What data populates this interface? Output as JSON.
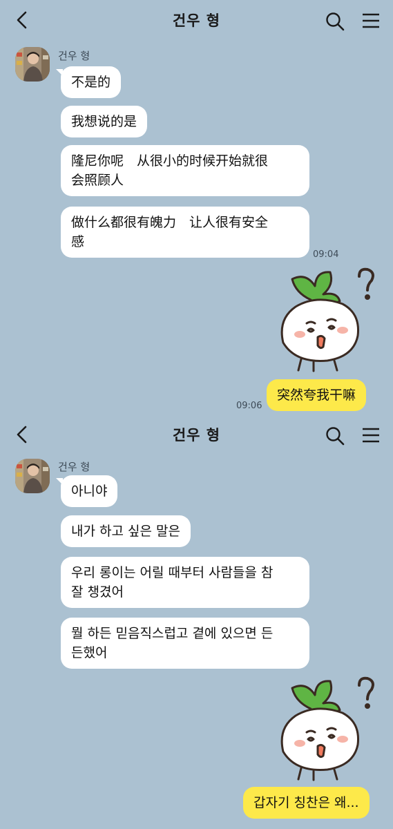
{
  "screens": [
    {
      "header": {
        "title": "건우 형"
      },
      "sender_name": "건우 형",
      "incoming": [
        "不是的",
        "我想说的是",
        "隆尼你呢　从很小的时候开始就很",
        "会照顾人",
        "做什么都很有魄力　让人很有安全",
        "感"
      ],
      "incoming_time": "09:04",
      "outgoing": "突然夸我干嘛",
      "outgoing_time": "09:06",
      "sticker_icon": "radish-confused-sticker"
    },
    {
      "header": {
        "title": "건우 형"
      },
      "sender_name": "건우 형",
      "incoming": [
        "아니야",
        "내가 하고 싶은 말은",
        "우리 롱이는 어릴 때부터 사람들을 참",
        "잘 챙겼어",
        "뭘 하든 믿음직스럽고 곁에 있으면 든",
        "든했어"
      ],
      "outgoing": "갑자기 칭찬은 왜...",
      "sticker_icon": "radish-confused-sticker"
    }
  ],
  "colors": {
    "background": "#abc1d1",
    "incoming_bubble": "#ffffff",
    "outgoing_bubble": "#fde94a",
    "radish_leaf": "#5fb544"
  }
}
